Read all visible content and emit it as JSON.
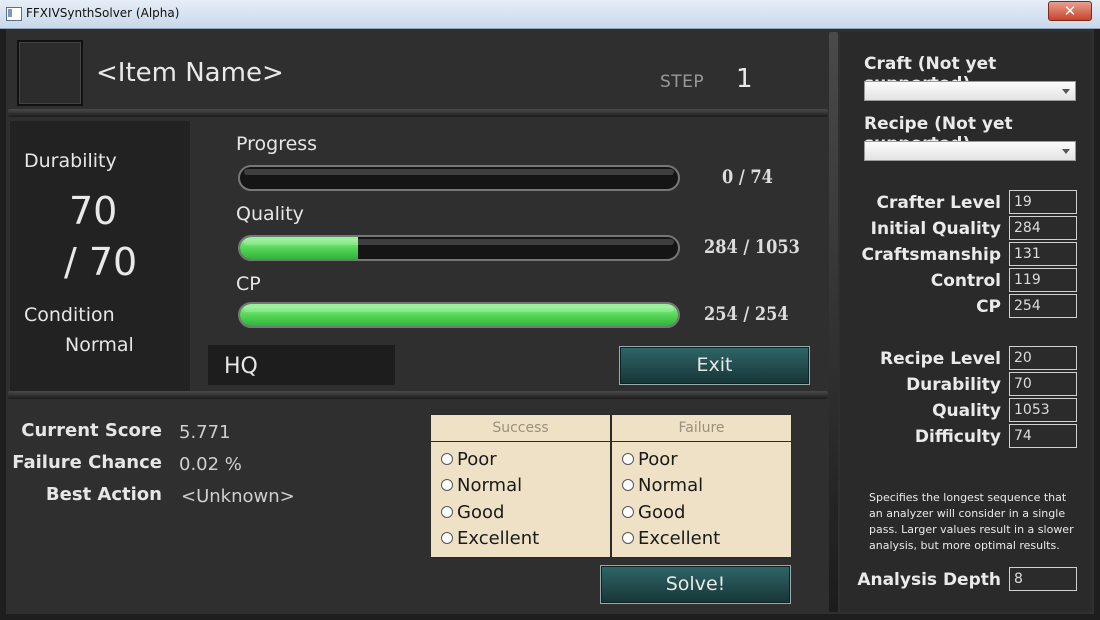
{
  "window": {
    "title": "FFXIVSynthSolver (Alpha)",
    "close_glyph": "✕"
  },
  "header": {
    "item_name": "<Item Name>",
    "step_label": "STEP",
    "step_value": "1"
  },
  "durability": {
    "label": "Durability",
    "current": "70",
    "max_text": "/ 70",
    "condition_label": "Condition",
    "condition_value": "Normal"
  },
  "bars": [
    {
      "label": "Progress",
      "value_text": "0 / 74",
      "fill_fraction": 0.0
    },
    {
      "label": "Quality",
      "value_text": "284 / 1053",
      "fill_fraction": 0.27
    },
    {
      "label": "CP",
      "value_text": "254 / 254",
      "fill_fraction": 1.0
    }
  ],
  "hq_label": "HQ",
  "exit_label": "Exit",
  "stats": [
    {
      "label": "Current Score",
      "value": "5.771"
    },
    {
      "label": "Failure Chance",
      "value": "0.02 %"
    },
    {
      "label": "Best Action",
      "value": "<Unknown>"
    }
  ],
  "success_table": {
    "header": "Success",
    "options": [
      "Poor",
      "Normal",
      "Good",
      "Excellent"
    ]
  },
  "failure_table": {
    "header": "Failure",
    "options": [
      "Poor",
      "Normal",
      "Good",
      "Excellent"
    ]
  },
  "solve_label": "Solve!",
  "craft_label": "Craft (Not yet supported)",
  "recipe_label": "Recipe (Not yet supported)",
  "crafter_fields": [
    {
      "label": "Crafter Level",
      "value": "19"
    },
    {
      "label": "Initial Quality",
      "value": "284"
    },
    {
      "label": "Craftsmanship",
      "value": "131"
    },
    {
      "label": "Control",
      "value": "119"
    },
    {
      "label": "CP",
      "value": "254"
    }
  ],
  "recipe_fields": [
    {
      "label": "Recipe Level",
      "value": "20"
    },
    {
      "label": "Durability",
      "value": "70"
    },
    {
      "label": "Quality",
      "value": "1053"
    },
    {
      "label": "Difficulty",
      "value": "74"
    }
  ],
  "hint_text": "Specifies the longest sequence that an analyzer will consider in a single pass. Larger values result in a slower analysis, but more optimal results.",
  "analysis_depth": {
    "label": "Analysis Depth",
    "value": "8"
  },
  "colors": {
    "accent_green": "#5cdb5c",
    "button_teal": "#2f6668",
    "panel_dark": "#2f2f2f",
    "table_bg": "#efe1c6"
  }
}
